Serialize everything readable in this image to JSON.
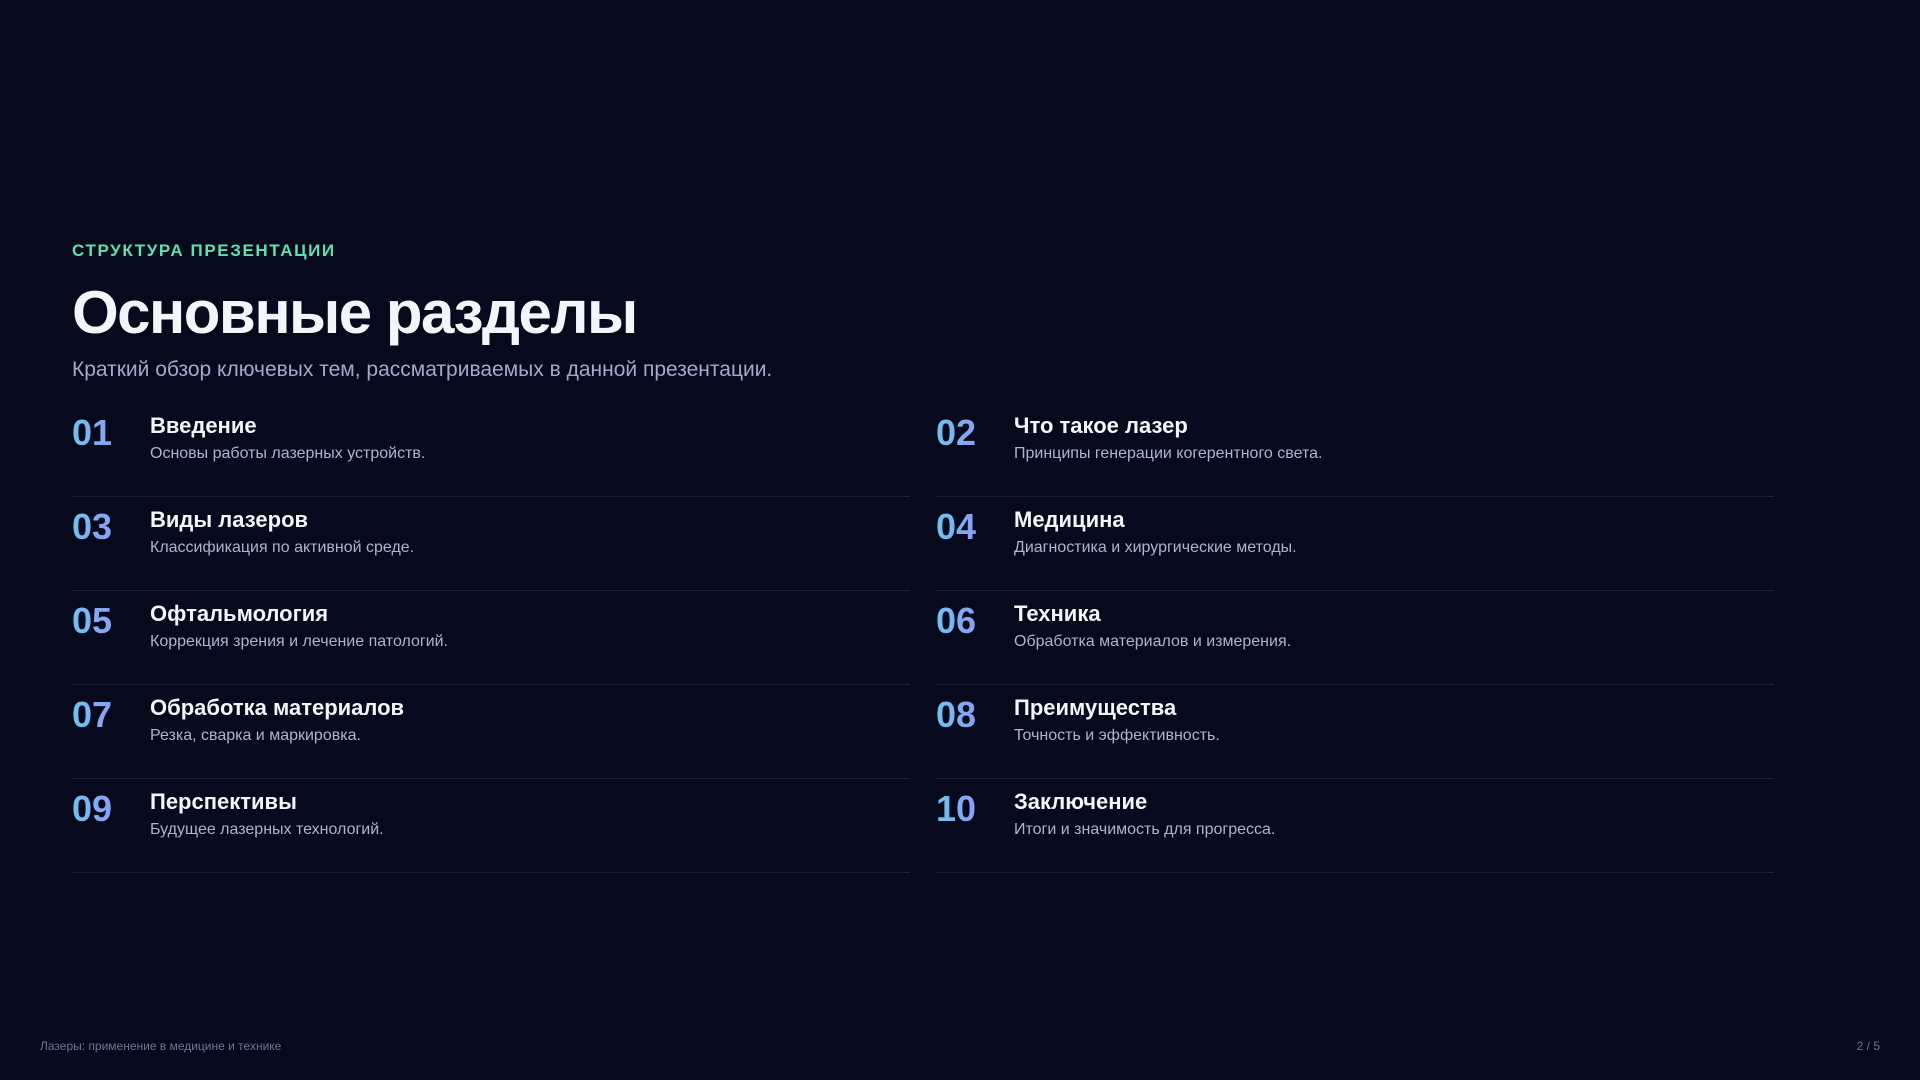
{
  "header": {
    "kicker": "СТРУКТУРА ПРЕЗЕНТАЦИИ",
    "title": "Основные разделы",
    "subtitle": "Краткий обзор ключевых тем, рассматриваемых в данной презентации."
  },
  "sections": [
    {
      "num": "01",
      "title": "Введение",
      "desc": "Основы работы лазерных устройств."
    },
    {
      "num": "02",
      "title": "Что такое лазер",
      "desc": "Принципы генерации когерентного света."
    },
    {
      "num": "03",
      "title": "Виды лазеров",
      "desc": "Классификация по активной среде."
    },
    {
      "num": "04",
      "title": "Медицина",
      "desc": "Диагностика и хирургические методы."
    },
    {
      "num": "05",
      "title": "Офтальмология",
      "desc": "Коррекция зрения и лечение патологий."
    },
    {
      "num": "06",
      "title": "Техника",
      "desc": "Обработка материалов и измерения."
    },
    {
      "num": "07",
      "title": "Обработка материалов",
      "desc": "Резка, сварка и маркировка."
    },
    {
      "num": "08",
      "title": "Преимущества",
      "desc": "Точность и эффективность."
    },
    {
      "num": "09",
      "title": "Перспективы",
      "desc": "Будущее лазерных технологий."
    },
    {
      "num": "10",
      "title": "Заключение",
      "desc": "Итоги и значимость для прогресса."
    }
  ],
  "footer": {
    "presentation_title": "Лазеры: применение в медицине и технике",
    "page_indicator": "2 / 5"
  },
  "colors": {
    "background": "#060a1c",
    "accent": "#5fe0b0",
    "number_gradient_start": "#6fc3f0",
    "number_gradient_end": "#9b8cf2"
  }
}
